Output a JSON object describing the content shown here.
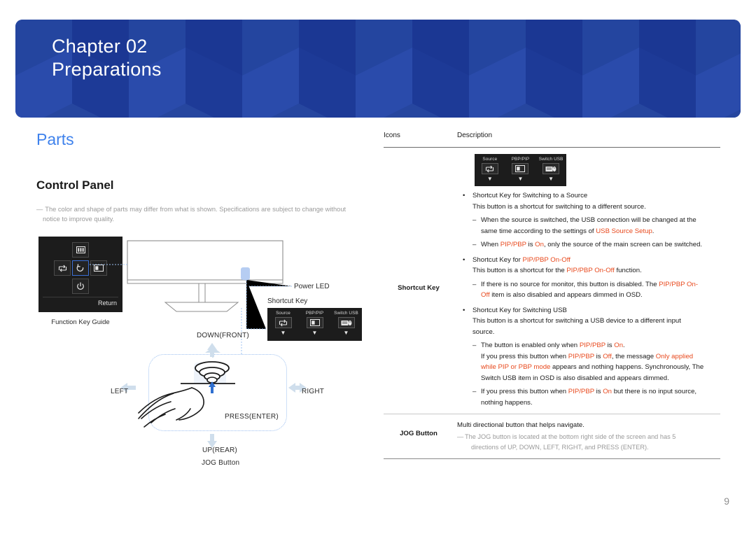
{
  "banner": {
    "chapter": "Chapter  02",
    "title": "Preparations",
    "bg_color": "#1f3d9e"
  },
  "left": {
    "section_heading": "Parts",
    "section_heading_color": "#3f82ec",
    "subsection_heading": "Control Panel",
    "note": "The color and shape of parts may differ from what is shown. Specifications are subject to change without",
    "note_cont": "notice to improve quality.",
    "function_key_guide": {
      "return_label": "Return",
      "caption": "Function Key Guide",
      "keys": [
        {
          "name": "menu-icon",
          "position": "up"
        },
        {
          "name": "source-loop-icon",
          "position": "left"
        },
        {
          "name": "return-arrow-icon",
          "position": "center"
        },
        {
          "name": "pbp-icon",
          "position": "right"
        },
        {
          "name": "power-icon",
          "position": "down"
        }
      ]
    },
    "monitor_labels": {
      "power_led": "Power LED",
      "shortcut_key": "Shortcut Key"
    },
    "shortcut_panel": {
      "buttons": [
        {
          "caption": "Source",
          "icon": "source-loop-icon"
        },
        {
          "caption": "PBP/PIP",
          "icon": "pbp-icon"
        },
        {
          "caption": "Switch USB",
          "icon": "switch-usb-icon"
        }
      ],
      "arrow_glyph": "▼"
    },
    "jog": {
      "down": "DOWN(FRONT)",
      "left": "LEFT",
      "right": "RIGHT",
      "press": "PRESS(ENTER)",
      "up": "UP(REAR)",
      "caption": "JOG Button"
    }
  },
  "table": {
    "headers": {
      "icons": "Icons",
      "description": "Description"
    },
    "rows": [
      {
        "label": "Shortcut Key",
        "panel": {
          "buttons": [
            {
              "caption": "Source",
              "icon": "source-loop-icon"
            },
            {
              "caption": "PBP/PIP",
              "icon": "pbp-icon"
            },
            {
              "caption": "Switch USB",
              "icon": "switch-usb-icon"
            }
          ],
          "arrow_glyph": "▼"
        },
        "blocks": {
          "b1_source": "Shortcut Key for Switching to a Source",
          "p1_source": "This button is a shortcut for switching to a different source.",
          "d1a": "When the source is switched, the USB connection will be changed at the",
          "d1b_pre": "same time according to the settings of ",
          "d1b_hl": "USB Source Setup",
          "d1b_post": ".",
          "d2_pre": "When ",
          "d2_hl1": "PIP/PBP",
          "d2_mid": " is ",
          "d2_hl2": "On",
          "d2_post": ", only the source of the main screen can be switched.",
          "b2_pre": "Shortcut Key for ",
          "b2_hl": "PIP/PBP On-Off",
          "p2_pre": "This button is a shortcut for the ",
          "p2_hl": "PIP/PBP On-Off",
          "p2_post": " function.",
          "d3a_pre": "If there is no source for monitor, this button is disabled. The ",
          "d3a_hl": "PIP/PBP On-",
          "d3b_hl": "Off",
          "d3b_post": " item is also disabled and appears dimmed in OSD.",
          "b3": "Shortcut Key for Switching USB",
          "p3a": "This button is a shortcut for switching a USB device to a different input",
          "p3b": "source.",
          "d4_pre": "The button is enabled only when ",
          "d4_hl1": "PIP/PBP",
          "d4_mid": " is ",
          "d4_hl2": "On",
          "d4_post": ".",
          "d5a_pre": "If you press this button when ",
          "d5a_hl1": "PIP/PBP",
          "d5a_mid": " is ",
          "d5a_hl2": "Off",
          "d5a_mid2": ", the message ",
          "d5a_hl3": "Only applied",
          "d5b_hl": "while PIP or PBP mode",
          "d5b_post": " appears and nothing happens. Synchronously, The",
          "d5c": "Switch USB item in OSD is also disabled and appears dimmed.",
          "d6a_pre": "If you press this button when ",
          "d6a_hl1": "PIP/PBP",
          "d6a_mid": " is ",
          "d6a_hl2": "On",
          "d6a_post": " but there is no input source,",
          "d6b": "nothing happens."
        }
      },
      {
        "label": "JOG Button",
        "desc": "Multi directional button that helps navigate.",
        "note_a": "The JOG button is located at the bottom right side of the screen and has 5",
        "note_b": "directions of UP, DOWN, LEFT, RIGHT, and PRESS (ENTER)."
      }
    ]
  },
  "footer": {
    "page_number": "9"
  },
  "colors": {
    "highlight": "#e8491d",
    "link_blue": "#3f82ec",
    "banner": "#1f3d9e"
  }
}
